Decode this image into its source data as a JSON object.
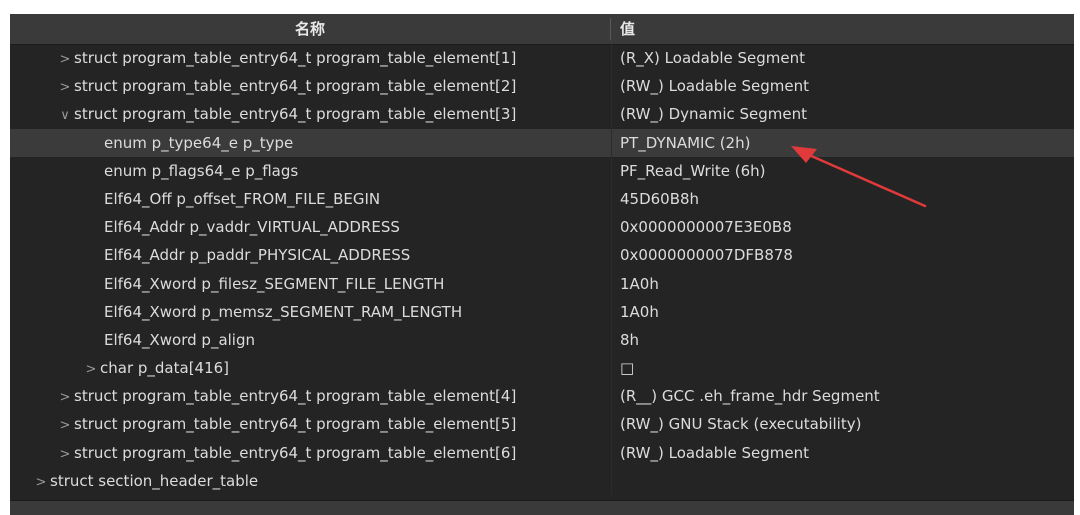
{
  "columns": {
    "name": "名称",
    "value": "值"
  },
  "rows": [
    {
      "toggle": ">",
      "name": "struct program_table_entry64_t program_table_element[1]",
      "value": "(R_X) Loadable Segment"
    },
    {
      "toggle": ">",
      "name": "struct program_table_entry64_t program_table_element[2]",
      "value": "(RW_) Loadable Segment"
    },
    {
      "toggle": "∨",
      "name": "struct program_table_entry64_t program_table_element[3]",
      "value": "(RW_) Dynamic Segment"
    },
    {
      "toggle": "",
      "name": "enum p_type64_e p_type",
      "value": "PT_DYNAMIC (2h)"
    },
    {
      "toggle": "",
      "name": "enum p_flags64_e p_flags",
      "value": "PF_Read_Write (6h)"
    },
    {
      "toggle": "",
      "name": "Elf64_Off p_offset_FROM_FILE_BEGIN",
      "value": "45D60B8h"
    },
    {
      "toggle": "",
      "name": "Elf64_Addr p_vaddr_VIRTUAL_ADDRESS",
      "value": "0x0000000007E3E0B8"
    },
    {
      "toggle": "",
      "name": "Elf64_Addr p_paddr_PHYSICAL_ADDRESS",
      "value": "0x0000000007DFB878"
    },
    {
      "toggle": "",
      "name": "Elf64_Xword p_filesz_SEGMENT_FILE_LENGTH",
      "value": "1A0h"
    },
    {
      "toggle": "",
      "name": "Elf64_Xword p_memsz_SEGMENT_RAM_LENGTH",
      "value": "1A0h"
    },
    {
      "toggle": "",
      "name": "Elf64_Xword p_align",
      "value": "8h"
    },
    {
      "toggle": ">",
      "name": "char p_data[416]",
      "value": "□"
    },
    {
      "toggle": ">",
      "name": "struct program_table_entry64_t program_table_element[4]",
      "value": "(R__) GCC .eh_frame_hdr Segment"
    },
    {
      "toggle": ">",
      "name": "struct program_table_entry64_t program_table_element[5]",
      "value": "(RW_) GNU Stack (executability)"
    },
    {
      "toggle": ">",
      "name": "struct program_table_entry64_t program_table_element[6]",
      "value": "(RW_) Loadable Segment"
    },
    {
      "toggle": ">",
      "name": "struct section_header_table",
      "value": ""
    }
  ],
  "colors": {
    "background": "#242424",
    "header": "#3a3a3a",
    "selected_row": "#3b3b3b",
    "text": "#dcdcdc",
    "annotation_arrow": "#e03a3a"
  },
  "annotation": {
    "icon": "red-arrow-icon"
  }
}
